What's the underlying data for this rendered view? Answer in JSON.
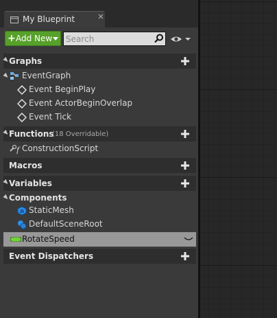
{
  "tab": {
    "label": "My Blueprint"
  },
  "toolbar": {
    "add_new_label": "Add New",
    "search_placeholder": "Search",
    "search_value": ""
  },
  "sections": {
    "graphs": {
      "title": "Graphs"
    },
    "functions": {
      "title": "Functions",
      "count": "(18 Overridable)"
    },
    "macros": {
      "title": "Macros"
    },
    "variables": {
      "title": "Variables"
    },
    "event_dispatchers": {
      "title": "Event Dispatchers"
    }
  },
  "graphs": {
    "event_graph": "EventGraph",
    "events": [
      "Event BeginPlay",
      "Event ActorBeginOverlap",
      "Event Tick"
    ]
  },
  "functions": {
    "items": [
      "ConstructionScript"
    ]
  },
  "components": {
    "title": "Components",
    "items": [
      "StaticMesh",
      "DefaultSceneRoot"
    ]
  },
  "variables": {
    "items": [
      {
        "name": "RotateSpeed",
        "selected": true
      }
    ]
  },
  "colors": {
    "add_new": "#57a12a",
    "panel": "#3a3a3a",
    "section_header": "#2e2e2e",
    "selected_row": "#989898",
    "variable_pill": "#73d13b",
    "component_icon": "#2f8fe6"
  },
  "icons": {
    "tab": "blueprint-icon",
    "close": "close-icon",
    "search": "magnifier-icon",
    "view_options": "eye-icon",
    "event": "event-diamond-icon",
    "function": "function-icon",
    "add": "plus-icon"
  }
}
